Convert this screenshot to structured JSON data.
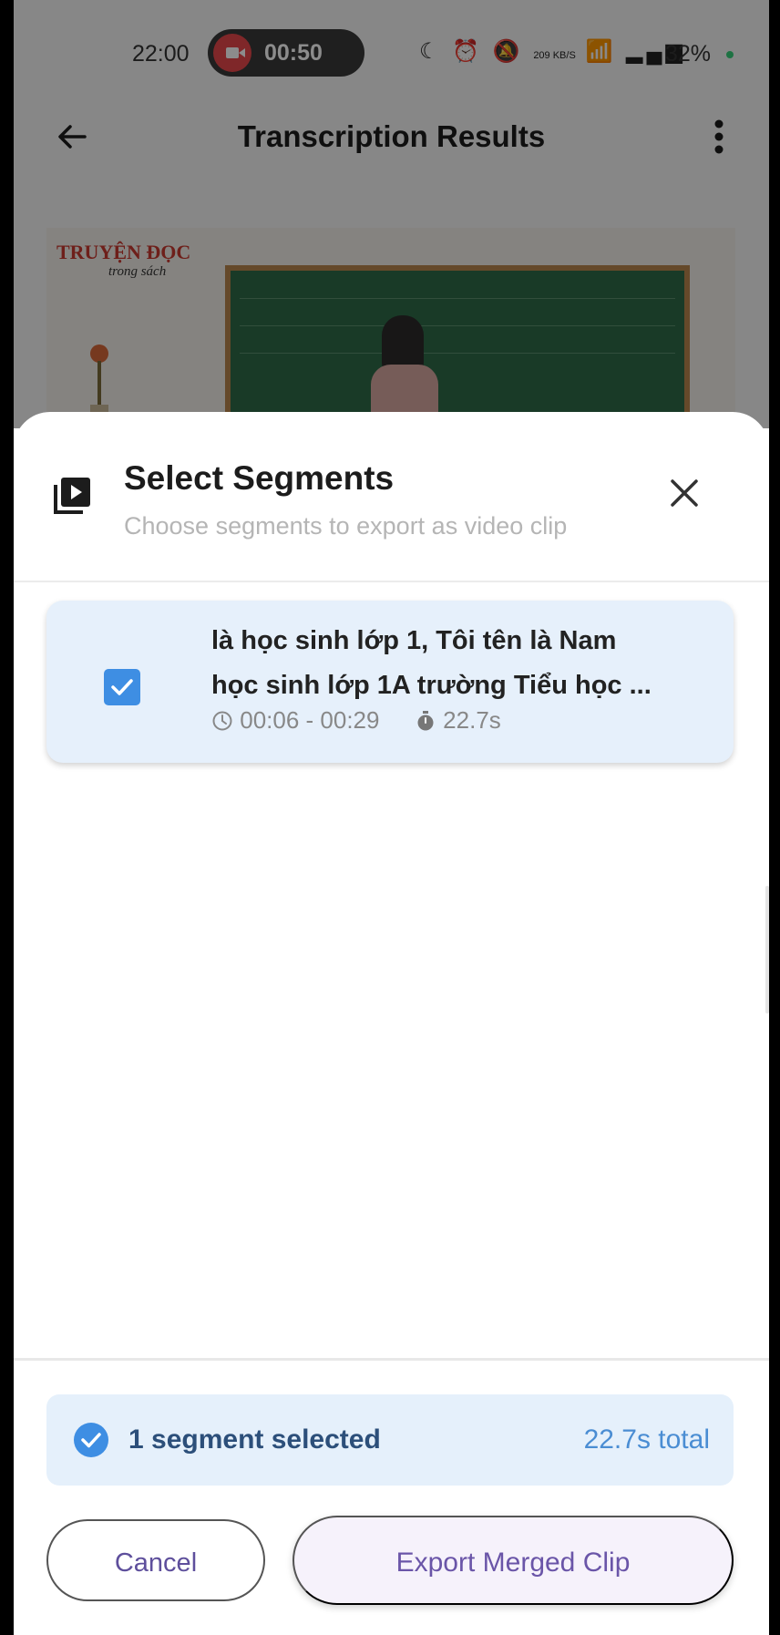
{
  "status_bar": {
    "time": "22:00",
    "recording_time": "00:50",
    "icons": [
      "moon-icon",
      "alarm-icon",
      "mute-icon",
      "data-speed-icon",
      "wifi-icon",
      "signal-icon"
    ],
    "data_speed": "209 KB/S",
    "battery": "32%"
  },
  "app_bar": {
    "title": "Transcription Results"
  },
  "video": {
    "logo_text": "TRUYỆN ĐỌC",
    "logo_subtext": "trong sách"
  },
  "sheet": {
    "title": "Select Segments",
    "subtitle": "Choose segments to export as video clip",
    "segments": [
      {
        "line1": "là học sinh lớp 1, Tôi tên là Nam",
        "line2": "học sinh lớp 1A trường Tiểu học ...",
        "time_range": "00:06 - 00:29",
        "duration": "22.7s",
        "selected": true
      }
    ],
    "summary": {
      "label": "1 segment selected",
      "total": "22.7s total"
    },
    "buttons": {
      "cancel": "Cancel",
      "export": "Export Merged Clip"
    }
  },
  "colors": {
    "accent_blue": "#3e8ee3",
    "card_bg": "#e6f0fb",
    "button_purple": "#6a55a8",
    "record_red": "#e8484b"
  }
}
